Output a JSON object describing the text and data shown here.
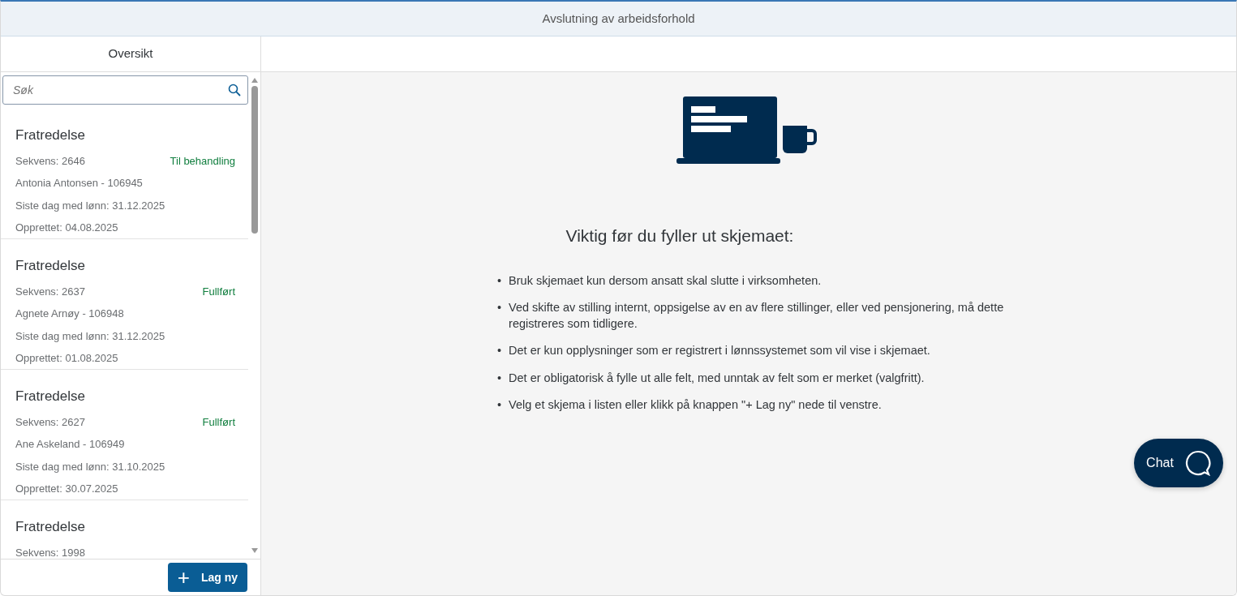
{
  "header": {
    "title": "Avslutning av arbeidsforhold"
  },
  "sidebar": {
    "tab": "Oversikt",
    "search": {
      "placeholder": "Søk"
    },
    "items": [
      {
        "title": "Fratredelse",
        "sequence": "Sekvens: 2646",
        "status": "Til behandling",
        "employee": "Antonia Antonsen - 106945",
        "last_day": "Siste dag med lønn: 31.12.2025",
        "created": "Opprettet: 04.08.2025"
      },
      {
        "title": "Fratredelse",
        "sequence": "Sekvens: 2637",
        "status": "Fullført",
        "employee": "Agnete Arnøy - 106948",
        "last_day": "Siste dag med lønn: 31.12.2025",
        "created": "Opprettet: 01.08.2025"
      },
      {
        "title": "Fratredelse",
        "sequence": "Sekvens: 2627",
        "status": "Fullført",
        "employee": "Ane Askeland - 106949",
        "last_day": "Siste dag med lønn: 31.10.2025",
        "created": "Opprettet: 30.07.2025"
      },
      {
        "title": "Fratredelse",
        "sequence": "Sekvens: 1998"
      }
    ],
    "new_button": {
      "icon": "+",
      "label": "Lag ny"
    }
  },
  "main": {
    "heading": "Viktig før du fyller ut skjemaet:",
    "bullets": [
      {
        "marker": "•",
        "text": "Bruk skjemaet kun dersom ansatt skal slutte i virksomheten."
      },
      {
        "marker": "•",
        "text": "Ved skifte av stilling internt, oppsigelse av en av flere stillinger, eller ved pensjonering, må dette registreres som tidligere."
      },
      {
        "marker": "•",
        "text": "Det er kun opplysninger som er registrert i lønnssystemet som vil vise i skjemaet."
      },
      {
        "marker": "•",
        "text": "Det er obligatorisk å fylle ut alle felt, med unntak av felt som er merket (valgfritt)."
      },
      {
        "marker": "•",
        "text": "Velg et skjema i listen eller klikk på knappen \"+ Lag ny\" nede til venstre."
      }
    ]
  },
  "chat": {
    "label": "Chat"
  }
}
